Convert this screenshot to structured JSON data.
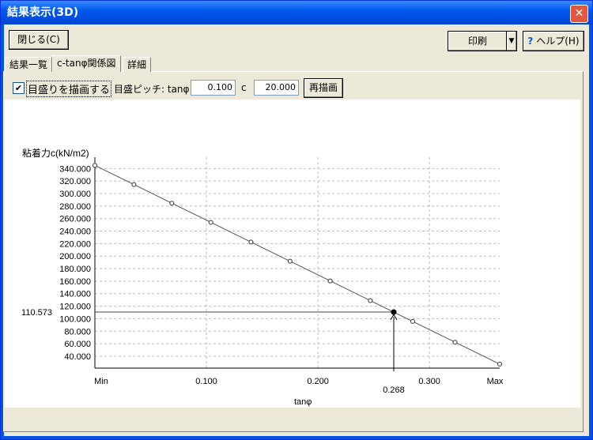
{
  "window": {
    "title": "結果表示(3D)",
    "close_glyph": "✕"
  },
  "toolbar": {
    "close_label": "閉じる(C)",
    "print_label": "印刷",
    "print_dropdown": "▼",
    "help_label": "ヘルプ(H)",
    "help_icon": "?"
  },
  "tabs": [
    {
      "label": "結果一覧"
    },
    {
      "label": "c-tanφ関係図",
      "active": true
    },
    {
      "label": "詳細"
    }
  ],
  "options": {
    "draw_scale_label": "目盛りを描画する",
    "draw_scale_checked": true,
    "check_glyph": "✔",
    "pitch_label": "目盛ピッチ: tanφ",
    "tan_pitch": "0.100",
    "c_label": "c",
    "c_pitch": "20.000",
    "redraw_label": "再描画"
  },
  "chart_data": {
    "type": "line",
    "ylabel": "粘着力c(kN/m2)",
    "xlabel": "tanφ",
    "xlim": [
      0,
      0.363
    ],
    "ylim": [
      21,
      348
    ],
    "x_ticks": [
      {
        "v": 0,
        "label": "Min"
      },
      {
        "v": 0.1,
        "label": "0.100"
      },
      {
        "v": 0.2,
        "label": "0.200"
      },
      {
        "v": 0.3,
        "label": "0.300"
      },
      {
        "v": 0.363,
        "label": "Max"
      }
    ],
    "y_ticks": [
      340,
      320,
      300,
      280,
      260,
      240,
      220,
      200,
      180,
      160,
      140,
      120,
      100,
      80,
      60,
      40
    ],
    "y_tick_labels": [
      "340.000",
      "320.000",
      "300.000",
      "280.000",
      "260.000",
      "240.000",
      "220.000",
      "200.000",
      "180.000",
      "160.000",
      "140.000",
      "120.000",
      "100.000",
      "80.000",
      "60.000",
      "40.000"
    ],
    "x": [
      0,
      0.035,
      0.069,
      0.104,
      0.14,
      0.175,
      0.211,
      0.247,
      0.285,
      0.323,
      0.363
    ],
    "y": [
      345,
      314.4,
      284.6,
      254,
      222.5,
      191.9,
      160.4,
      128.9,
      95.6,
      62.4,
      27.4
    ],
    "marker": {
      "x": 0.268,
      "y": 110.573,
      "x_label": "0.268",
      "y_label": "110.573"
    },
    "grid": true
  }
}
